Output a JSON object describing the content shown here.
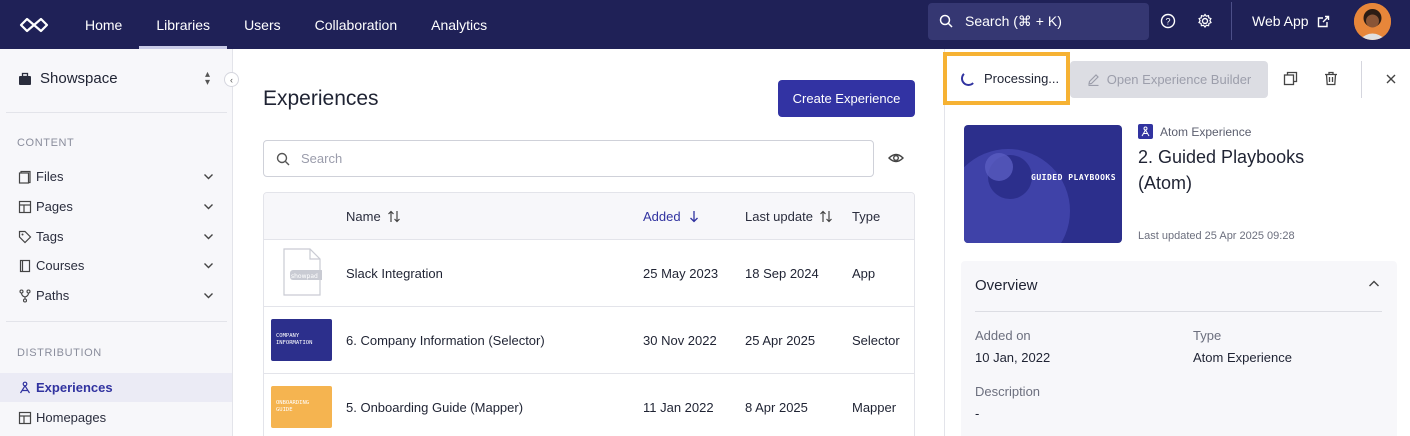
{
  "topnav": {
    "links": [
      "Home",
      "Libraries",
      "Users",
      "Collaboration",
      "Analytics"
    ],
    "active": "Libraries",
    "search_label": "Search (⌘ + K)",
    "web_app_label": "Web App"
  },
  "sidebar": {
    "workspace": "Showspace",
    "content_section": "CONTENT",
    "content_items": [
      {
        "label": "Files",
        "icon": "files-icon"
      },
      {
        "label": "Pages",
        "icon": "pages-icon"
      },
      {
        "label": "Tags",
        "icon": "tag-icon"
      },
      {
        "label": "Courses",
        "icon": "book-icon"
      },
      {
        "label": "Paths",
        "icon": "branch-icon"
      }
    ],
    "distribution_section": "DISTRIBUTION",
    "distribution_items": [
      {
        "label": "Experiences",
        "icon": "experience-icon",
        "active": true
      },
      {
        "label": "Homepages",
        "icon": "homepage-icon",
        "active": false
      }
    ]
  },
  "main": {
    "title": "Experiences",
    "create_label": "Create Experience",
    "search_placeholder": "Search",
    "columns": {
      "name": "Name",
      "added": "Added",
      "last_update": "Last update",
      "type": "Type"
    },
    "rows": [
      {
        "name": "Slack Integration",
        "added": "25 May 2023",
        "last_update": "18 Sep 2024",
        "type": "App",
        "thumb_label": "showpad"
      },
      {
        "name": "6. Company Information (Selector)",
        "added": "30 Nov 2022",
        "last_update": "25 Apr 2025",
        "type": "Selector",
        "thumb_label": "COMPANY INFORMATION"
      },
      {
        "name": "5. Onboarding Guide (Mapper)",
        "added": "11 Jan 2022",
        "last_update": "8 Apr 2025",
        "type": "Mapper",
        "thumb_label": "ONBOARDING GUIDE"
      }
    ]
  },
  "panel": {
    "processing_label": "Processing...",
    "builder_label": "Open Experience Builder",
    "cover_text": "GUIDED PLAYBOOKS",
    "exp_type": "Atom Experience",
    "exp_title": "2. Guided Playbooks (Atom)",
    "last_updated": "Last updated 25 Apr 2025 09:28",
    "overview": {
      "heading": "Overview",
      "added_on_label": "Added on",
      "added_on_value": "10 Jan, 2022",
      "type_label": "Type",
      "type_value": "Atom Experience",
      "description_label": "Description",
      "description_value": "-"
    }
  },
  "colors": {
    "nav_bg": "#1f2157",
    "accent": "#3233a3",
    "highlight": "#f6b233"
  }
}
